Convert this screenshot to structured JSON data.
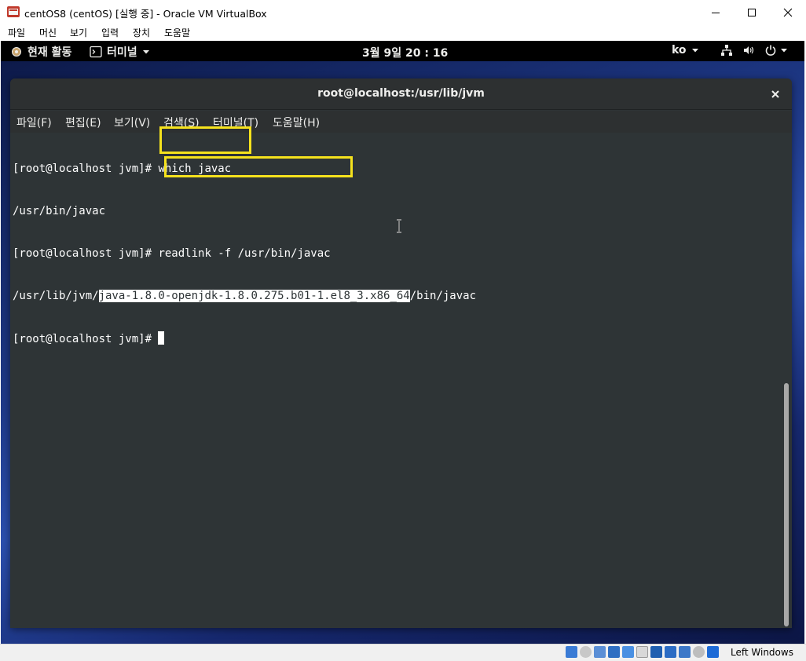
{
  "host_window": {
    "title": "centOS8 (centOS) [실행 중] - Oracle VM VirtualBox",
    "menu": [
      "파일",
      "머신",
      "보기",
      "입력",
      "장치",
      "도움말"
    ],
    "controls": {
      "minimize": "minimize-icon",
      "maximize": "maximize-icon",
      "close": "close-icon"
    }
  },
  "gnome_topbar": {
    "activities": "현재 활동",
    "app_menu": "터미널",
    "clock": "3월 9일  20 : 16",
    "input_method": "ko",
    "tray_icons": [
      "network-icon",
      "volume-icon",
      "power-icon"
    ]
  },
  "terminal": {
    "title": "root@localhost:/usr/lib/jvm",
    "menu": [
      "파일(F)",
      "편집(E)",
      "보기(V)",
      "검색(S)",
      "터미널(T)",
      "도움말(H)"
    ],
    "lines": {
      "l1_prompt": "[root@localhost jvm]# ",
      "l1_cmd": "which javac",
      "l2_output": "/usr/bin/javac",
      "l3_prompt": "[root@localhost jvm]# ",
      "l3_cmd": "readlink -f /usr/bin/javac",
      "l4_prefix": "/usr/lib/jvm/",
      "l4_selected": "java-1.8.0-openjdk-1.8.0.275.b01-1.el8_3.x86_64",
      "l4_suffix": "/bin/javac",
      "l5_prompt": "[root@localhost jvm]# "
    },
    "highlight_color": "#f5e21d",
    "background_color": "#2e3436"
  },
  "status_bar": {
    "host_key": "Left Windows"
  }
}
